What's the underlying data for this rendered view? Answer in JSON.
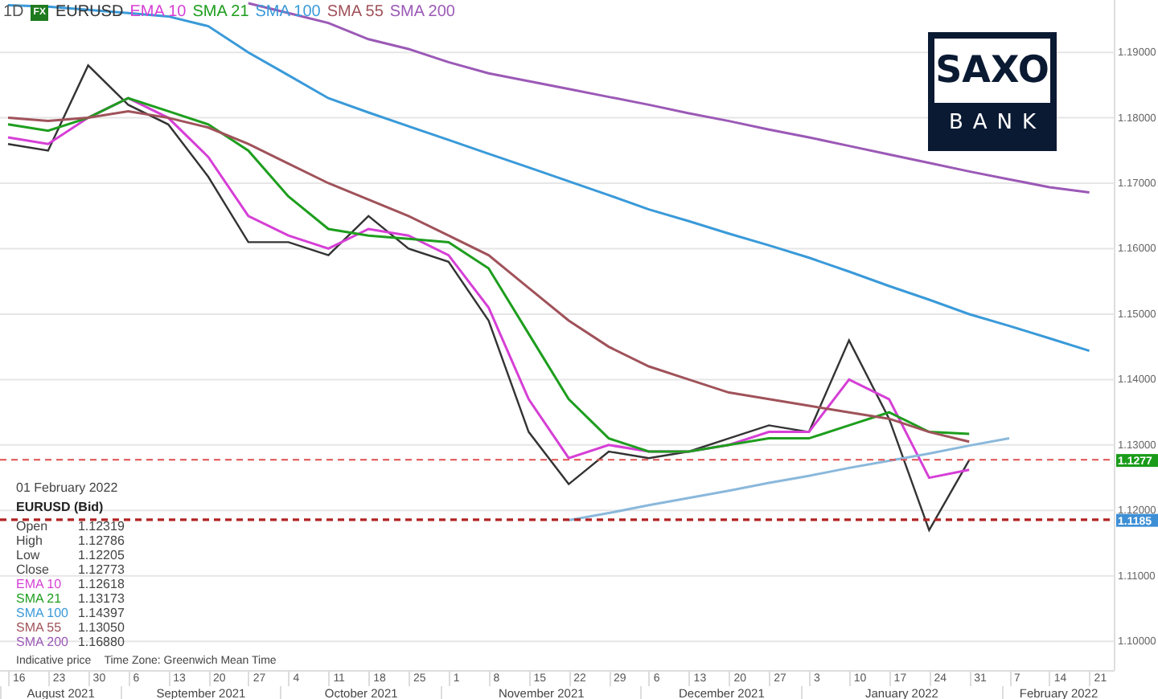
{
  "legend": {
    "interval": "1D",
    "badge": "FX"
  },
  "logo": {
    "top": "SAXO",
    "bottom": "BANK"
  },
  "chart": {
    "chart_data": {
      "type": "line",
      "categories": [
        "16",
        "23",
        "30",
        "6",
        "13",
        "20",
        "27",
        "4",
        "11",
        "18",
        "25",
        "1",
        "8",
        "15",
        "22",
        "29",
        "6",
        "13",
        "20",
        "27",
        "3",
        "10",
        "17",
        "24",
        "31",
        "7",
        "14",
        "21"
      ],
      "ylim": [
        1.0956,
        1.198
      ],
      "grid": true,
      "yticks": [
        {
          "value": 1.1,
          "label": "1.10000"
        },
        {
          "value": 1.11,
          "label": "1.11000"
        },
        {
          "value": 1.12,
          "label": "1.12000"
        },
        {
          "value": 1.13,
          "label": "1.13000"
        },
        {
          "value": 1.14,
          "label": "1.14000"
        },
        {
          "value": 1.15,
          "label": "1.15000"
        },
        {
          "value": 1.16,
          "label": "1.16000"
        },
        {
          "value": 1.17,
          "label": "1.17000"
        },
        {
          "value": 1.18,
          "label": "1.18000"
        },
        {
          "value": 1.19,
          "label": "1.19000"
        }
      ],
      "series": [
        {
          "name": "EURUSD",
          "color": "#333333",
          "values": [
            1.176,
            1.175,
            1.188,
            1.182,
            1.179,
            1.171,
            1.161,
            1.161,
            1.159,
            1.165,
            1.16,
            1.158,
            1.149,
            1.132,
            1.124,
            1.129,
            1.128,
            1.129,
            1.131,
            1.133,
            1.132,
            1.146,
            1.134,
            1.117,
            1.1277,
            null,
            null,
            null
          ]
        },
        {
          "name": "EMA 10",
          "color": "#d63fd6",
          "values": [
            1.177,
            1.176,
            1.18,
            1.183,
            1.18,
            1.174,
            1.165,
            1.162,
            1.16,
            1.163,
            1.162,
            1.159,
            1.151,
            1.137,
            1.128,
            1.13,
            1.129,
            1.129,
            1.13,
            1.132,
            1.132,
            1.14,
            1.137,
            1.125,
            1.1262,
            null,
            null,
            null
          ]
        },
        {
          "name": "SMA 21",
          "color": "#1e9e1e",
          "values": [
            1.179,
            1.178,
            1.18,
            1.183,
            1.181,
            1.179,
            1.175,
            1.168,
            1.163,
            1.162,
            1.1615,
            1.161,
            1.157,
            1.147,
            1.137,
            1.131,
            1.129,
            1.129,
            1.13,
            1.131,
            1.131,
            1.133,
            1.135,
            1.132,
            1.1317,
            null,
            null,
            null
          ]
        },
        {
          "name": "SMA 100",
          "color": "#3a9ad9",
          "values": [
            1.1972,
            1.197,
            1.1965,
            1.196,
            1.1955,
            1.194,
            1.19,
            1.1865,
            1.183,
            1.1808,
            1.1787,
            1.1766,
            1.1745,
            1.1724,
            1.1703,
            1.1682,
            1.166,
            1.1642,
            1.1623,
            1.1605,
            1.1586,
            1.1565,
            1.1543,
            1.1522,
            1.15,
            1.1482,
            1.1463,
            1.1444
          ]
        },
        {
          "name": "SMA 55",
          "color": "#a0525a",
          "values": [
            1.18,
            1.1795,
            1.18,
            1.181,
            1.18,
            1.1785,
            1.176,
            1.173,
            1.17,
            1.1675,
            1.165,
            1.162,
            1.159,
            1.154,
            1.149,
            1.145,
            1.142,
            1.14,
            1.138,
            1.137,
            1.136,
            1.135,
            1.134,
            1.132,
            1.1305,
            null,
            null,
            null
          ]
        },
        {
          "name": "SMA 200",
          "color": "#9b59b6",
          "values": [
            null,
            null,
            null,
            null,
            null,
            null,
            1.1975,
            1.196,
            1.1945,
            1.192,
            1.1905,
            1.1885,
            1.1868,
            1.1856,
            1.1844,
            1.1832,
            1.182,
            1.1807,
            1.1795,
            1.1782,
            1.177,
            1.1757,
            1.1744,
            1.1731,
            1.1718,
            1.1706,
            1.1694,
            1.1686
          ]
        },
        {
          "color": "#8ab8db",
          "values": [
            null,
            null,
            null,
            null,
            null,
            null,
            null,
            null,
            null,
            null,
            null,
            null,
            null,
            null,
            1.1185,
            1.1196,
            1.1208,
            1.1219,
            1.123,
            1.1242,
            1.1253,
            1.1265,
            1.1276,
            1.1287,
            1.1299,
            1.131,
            null,
            null
          ]
        }
      ],
      "ref_lines": [
        {
          "axis": "y",
          "value": 1.12773,
          "color": "#e05050"
        },
        {
          "axis": "y",
          "value": 1.11858,
          "color": "#b22222"
        }
      ]
    },
    "price_tags": [
      {
        "label": "1.1277",
        "color": "#1a9c1a"
      },
      {
        "label": "1.1185",
        "color": "#3d8fd6"
      }
    ],
    "months": [
      "August 2021",
      "September 2021",
      "October 2021",
      "November 2021",
      "December 2021",
      "January 2022",
      "February 2022"
    ]
  },
  "info_box": {
    "date": "01 February 2022",
    "title": "EURUSD (Bid)",
    "rows": [
      {
        "label": "Open",
        "value": "1.12319"
      },
      {
        "label": "High",
        "value": "1.12786"
      },
      {
        "label": "Low",
        "value": "1.12205"
      },
      {
        "label": "Close",
        "value": "1.12773"
      },
      {
        "label": "EMA 10",
        "value": "1.12618",
        "color": "#d63fd6"
      },
      {
        "label": "SMA 21",
        "value": "1.13173",
        "color": "#1e9e1e"
      },
      {
        "label": "SMA 100",
        "value": "1.14397",
        "color": "#3a9ad9"
      },
      {
        "label": "SMA 55",
        "value": "1.13050",
        "color": "#a0525a"
      },
      {
        "label": "SMA 200",
        "value": "1.16880",
        "color": "#9b59b6"
      }
    ]
  },
  "footer": {
    "note": "Indicative price",
    "timezone": "Time Zone: Greenwich Mean Time"
  }
}
